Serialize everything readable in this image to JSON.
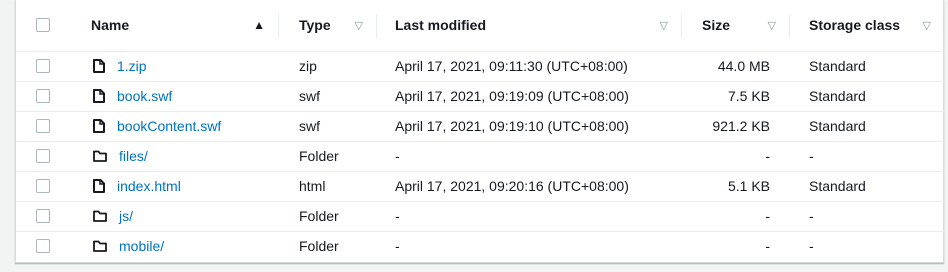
{
  "columns": {
    "name": "Name",
    "type": "Type",
    "last_modified": "Last modified",
    "size": "Size",
    "storage_class": "Storage class"
  },
  "sort": {
    "active_icon": "▲",
    "inactive_icon": "▽"
  },
  "rows": [
    {
      "name": "1.zip",
      "icon": "file-icon",
      "type": "zip",
      "last_modified": "April 17, 2021, 09:11:30 (UTC+08:00)",
      "size": "44.0 MB",
      "storage_class": "Standard"
    },
    {
      "name": "book.swf",
      "icon": "file-icon",
      "type": "swf",
      "last_modified": "April 17, 2021, 09:19:09 (UTC+08:00)",
      "size": "7.5 KB",
      "storage_class": "Standard"
    },
    {
      "name": "bookContent.swf",
      "icon": "file-icon",
      "type": "swf",
      "last_modified": "April 17, 2021, 09:19:10 (UTC+08:00)",
      "size": "921.2 KB",
      "storage_class": "Standard"
    },
    {
      "name": "files/",
      "icon": "folder-icon",
      "type": "Folder",
      "last_modified": "-",
      "size": "-",
      "storage_class": "-"
    },
    {
      "name": "index.html",
      "icon": "file-icon",
      "type": "html",
      "last_modified": "April 17, 2021, 09:20:16 (UTC+08:00)",
      "size": "5.1 KB",
      "storage_class": "Standard"
    },
    {
      "name": "js/",
      "icon": "folder-icon",
      "type": "Folder",
      "last_modified": "-",
      "size": "-",
      "storage_class": "-"
    },
    {
      "name": "mobile/",
      "icon": "folder-icon",
      "type": "Folder",
      "last_modified": "-",
      "size": "-",
      "storage_class": "-"
    }
  ]
}
